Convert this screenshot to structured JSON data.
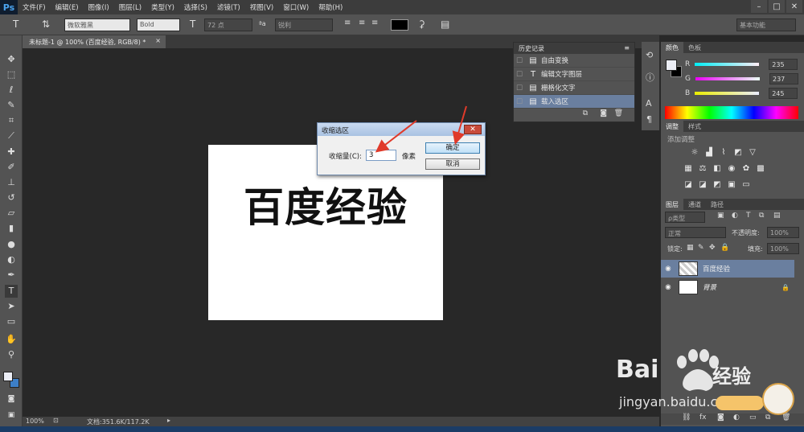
{
  "app": {
    "logo": "Ps"
  },
  "menu": [
    "文件(F)",
    "编辑(E)",
    "图像(I)",
    "图层(L)",
    "类型(Y)",
    "选择(S)",
    "滤镜(T)",
    "视图(V)",
    "窗口(W)",
    "帮助(H)"
  ],
  "window_controls": {
    "minimize": "–",
    "maximize": "□",
    "close": "✕"
  },
  "options": {
    "font_family": "微软雅黑",
    "font_style": "Bold",
    "font_size": "72 点",
    "aa_label": "ªa",
    "anti_alias": "锐利",
    "workspace": "基本功能",
    "text_color": "#000000"
  },
  "document": {
    "tab_title": "未标题-1 @ 100% (百度经验, RGB/8) *",
    "tab_close": "×",
    "canvas_text": "百度经验"
  },
  "status": {
    "zoom": "100%",
    "doc_info": "文档:351.6K/117.2K"
  },
  "history": {
    "title": "历史记录",
    "items": [
      {
        "icon": "▤",
        "label": "自由变换"
      },
      {
        "icon": "T",
        "label": "编辑文字图层"
      },
      {
        "icon": "▤",
        "label": "栅格化文字"
      },
      {
        "icon": "▤",
        "label": "载入选区"
      }
    ]
  },
  "color_panel": {
    "tabs": [
      "颜色",
      "色板"
    ],
    "r_label": "R",
    "g_label": "G",
    "b_label": "B",
    "r": "235",
    "g": "237",
    "b": "245",
    "foreground": "#ebedf5",
    "background": "#000000"
  },
  "adjust_panel": {
    "tabs": [
      "调整",
      "样式"
    ],
    "add_label": "添加调整"
  },
  "layers_panel": {
    "tabs": [
      "图层",
      "通道",
      "路径"
    ],
    "kind_filter": "ρ类型",
    "blend_mode": "正常",
    "opacity_label": "不透明度:",
    "opacity": "100%",
    "lock_label": "锁定:",
    "fill_label": "填充:",
    "fill": "100%",
    "layers": [
      {
        "name": "百度经验",
        "selected": true
      },
      {
        "name": "背景",
        "selected": false
      }
    ]
  },
  "shrink_dialog": {
    "title": "收缩选区",
    "close": "✕",
    "field_label": "收缩量(C):",
    "value": "3",
    "unit": "像素",
    "ok": "确定",
    "cancel": "取消"
  },
  "watermark": {
    "brand_latin": "Bai",
    "brand_cn": "经验",
    "url": "jingyan.baidu.com"
  },
  "colors": {
    "accent_arrow": "#e03a2a",
    "selection_blue": "#6a7f9f"
  }
}
